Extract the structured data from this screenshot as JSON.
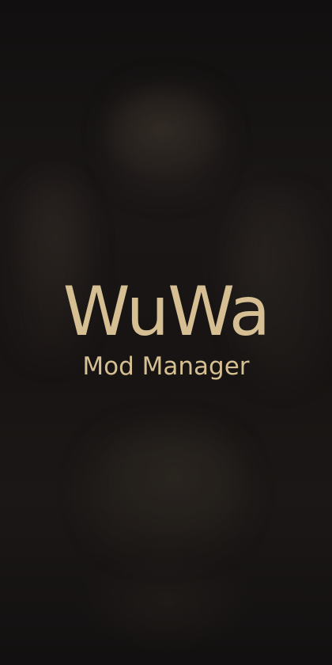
{
  "splash": {
    "title": "WuWa",
    "subtitle": "Mod Manager",
    "accent_color": "#d5bf93",
    "background_color": "#141111"
  }
}
